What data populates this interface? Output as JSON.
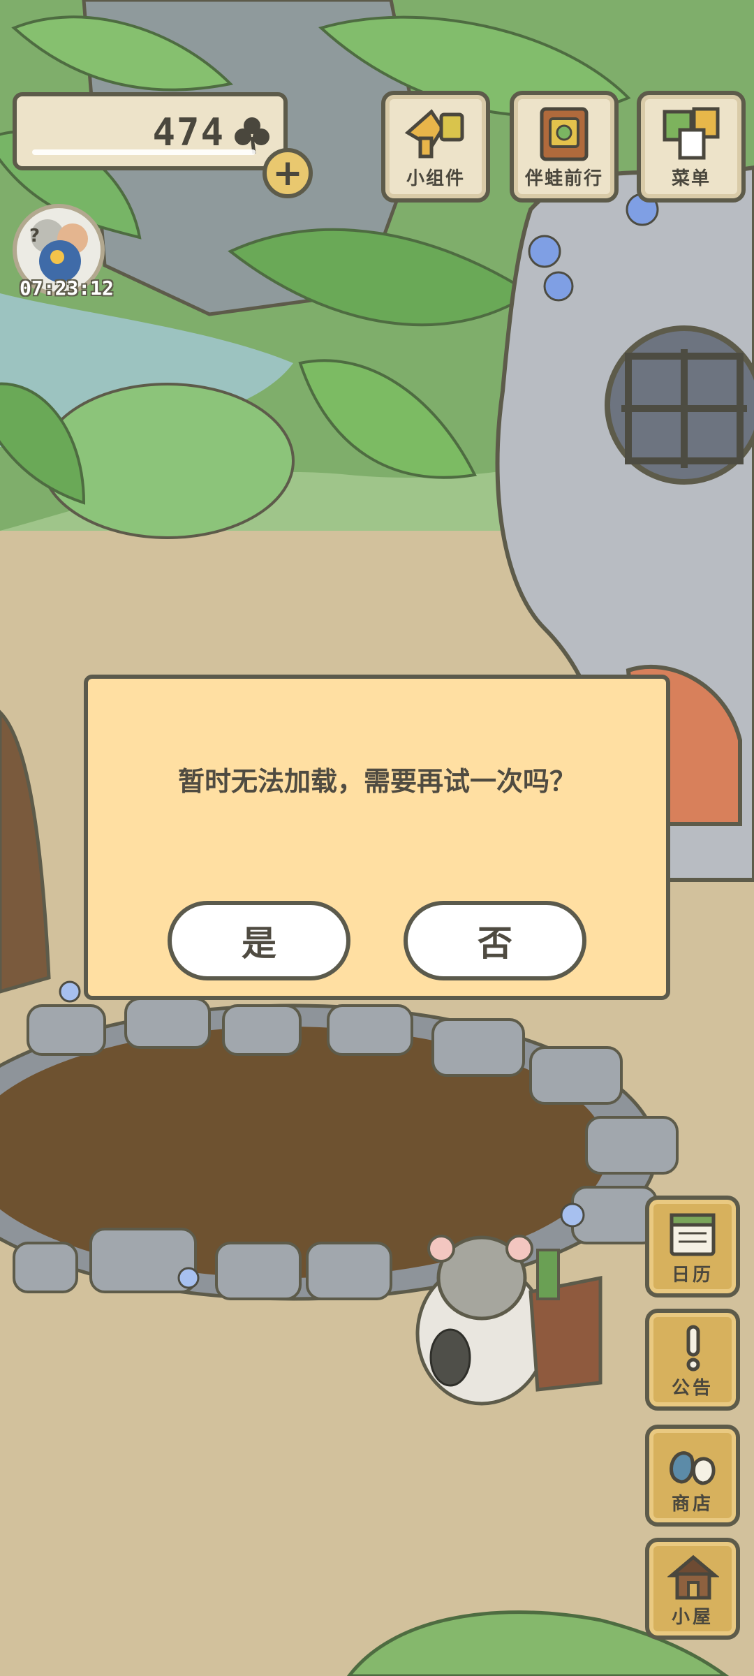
{
  "game": {
    "clover_count": "474",
    "visitor_timer": "07:23:12"
  },
  "top_menu": {
    "widgets_label": "小组件",
    "travel_label": "伴蛙前行",
    "menu_label": "菜单"
  },
  "side_menu": {
    "calendar_label": "日历",
    "notice_label": "公告",
    "shop_label": "商店",
    "house_label": "小屋"
  },
  "dialog": {
    "message": "暂时无法加载，需要再试一次吗？",
    "yes_label": "是",
    "no_label": "否"
  },
  "colors": {
    "dialog_bg": "#ffdfa2",
    "outline": "#5b5a4c",
    "panel": "#ede3c9",
    "wood": "#d7b15d"
  }
}
